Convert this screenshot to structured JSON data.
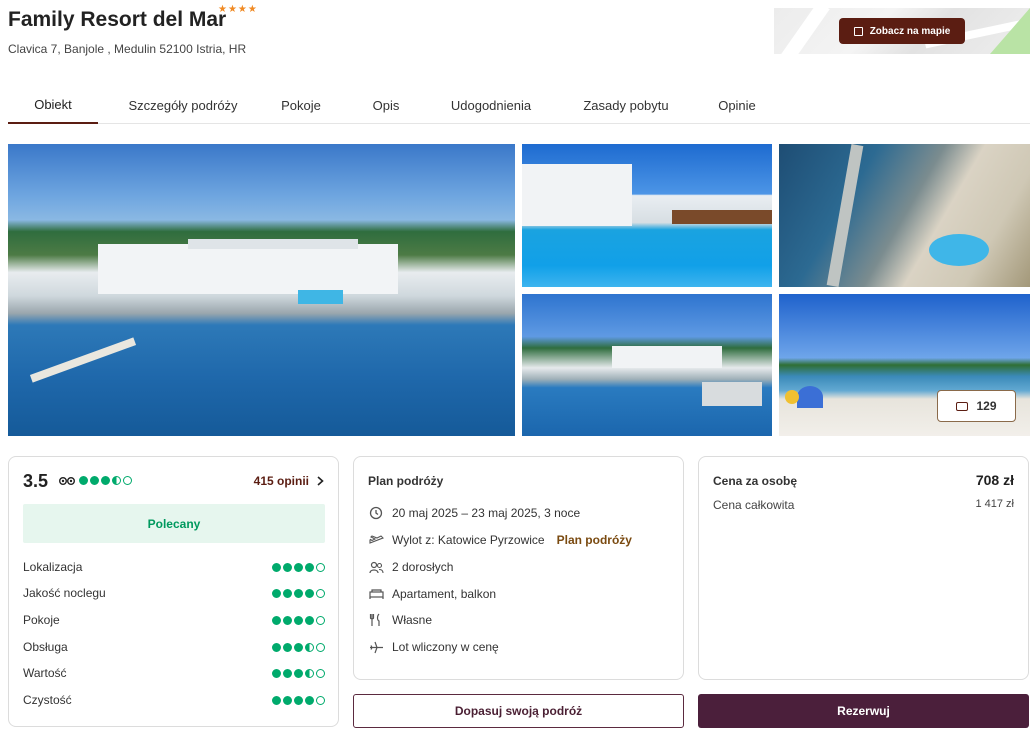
{
  "hotel": {
    "name": "Family Resort del Mar",
    "stars": "★★★★",
    "address": "Clavica 7, Banjole , Medulin 52100 Istria, HR"
  },
  "map": {
    "button_label": "Zobacz na mapie"
  },
  "tabs": [
    {
      "label": "Obiekt",
      "active": true
    },
    {
      "label": "Szczegóły podróży"
    },
    {
      "label": "Pokoje"
    },
    {
      "label": "Opis"
    },
    {
      "label": "Udogodnienia"
    },
    {
      "label": "Zasady pobytu"
    },
    {
      "label": "Opinie"
    }
  ],
  "gallery": {
    "photo_count": "129"
  },
  "rating": {
    "score": "3.5",
    "score_dots": 3.5,
    "reviews_link": "415 opinii",
    "recommended": "Polecany",
    "criteria": [
      {
        "label": "Lokalizacja",
        "value": 4
      },
      {
        "label": "Jakość noclegu",
        "value": 4
      },
      {
        "label": "Pokoje",
        "value": 4
      },
      {
        "label": "Obsługa",
        "value": 3.5
      },
      {
        "label": "Wartość",
        "value": 3.5
      },
      {
        "label": "Czystość",
        "value": 4
      }
    ]
  },
  "plan": {
    "title": "Plan podróży",
    "dates": "20 maj 2025 – 23 maj 2025, 3 noce",
    "flight": "Wylot z: Katowice Pyrzowice",
    "flight_link": "Plan podróży",
    "guests": "2 dorosłych",
    "room": "Apartament, balkon",
    "board": "Własne",
    "transport": "Lot wliczony w cenę"
  },
  "price": {
    "per_person_label": "Cena za osobę",
    "per_person_value": "708 zł",
    "total_label": "Cena całkowita",
    "total_value": "1 417 zł"
  },
  "buttons": {
    "adjust": "Dopasuj swoją podróż",
    "book": "Rezerwuj"
  },
  "colors": {
    "brand": "#5b1d12",
    "book_button": "#4b1f3b",
    "rating_green": "#00aa6c",
    "stars": "#f08a24"
  }
}
